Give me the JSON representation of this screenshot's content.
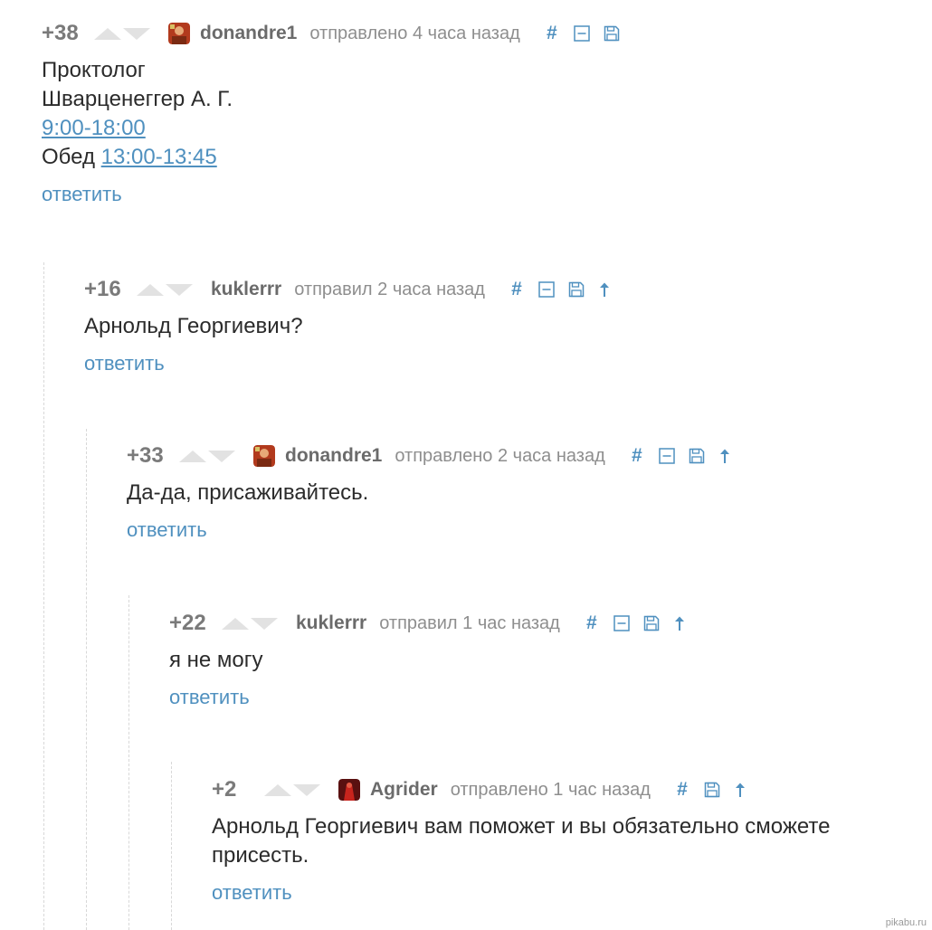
{
  "comments": [
    {
      "rating": "+38",
      "author": "donandre1",
      "time": "отправлено 4 часа назад",
      "body": {
        "line1": "Проктолог",
        "line2": "Шварценеггер А. Г.",
        "hours": "9:00-18:00",
        "lunch_label": "Обед",
        "lunch_time": "13:00-13:45"
      },
      "reply": "ответить"
    },
    {
      "rating": "+16",
      "author": "kuklerrr",
      "time": "отправил 2 часа назад",
      "body": "Арнольд Георгиевич?",
      "reply": "ответить"
    },
    {
      "rating": "+33",
      "author": "donandre1",
      "time": "отправлено 2 часа назад",
      "body": "Да-да, присаживайтесь.",
      "reply": "ответить"
    },
    {
      "rating": "+22",
      "author": "kuklerrr",
      "time": "отправил 1 час назад",
      "body": "я не могу",
      "reply": "ответить"
    },
    {
      "rating": "+2",
      "author": "Agrider",
      "time": "отправлено 1 час назад",
      "body_line1": "Арнольд Георгиевич вам поможет и вы обязательно сможете",
      "body_line2": "присесть.",
      "reply": "ответить"
    }
  ],
  "icons": {
    "link": "#",
    "collapse": "collapse-icon",
    "save": "save-icon",
    "parent": "arrow-up-icon"
  },
  "colors": {
    "link_blue": "#4f90bf",
    "rating_gray": "#7a7a7a",
    "vote_arrow": "#e2e2e2"
  },
  "watermark": "pikabu.ru"
}
